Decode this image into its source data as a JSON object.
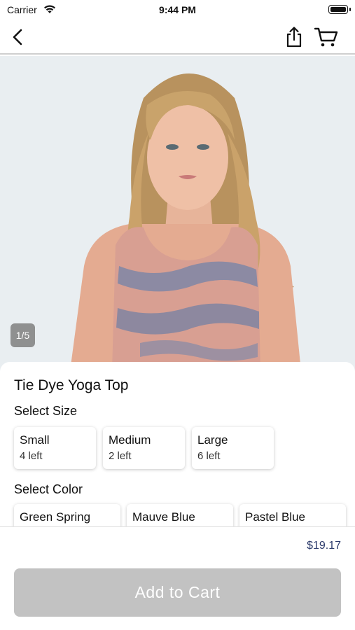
{
  "status_bar": {
    "carrier": "Carrier",
    "time": "9:44 PM"
  },
  "nav": {
    "back_icon": "chevron-left-icon",
    "share_icon": "share-icon",
    "cart_icon": "cart-icon"
  },
  "gallery": {
    "indicator": "1/5"
  },
  "product": {
    "title": "Tie Dye Yoga Top",
    "size_section_label": "Select Size",
    "sizes": [
      {
        "name": "Small",
        "stock": "4 left"
      },
      {
        "name": "Medium",
        "stock": "2 left"
      },
      {
        "name": "Large",
        "stock": "6 left"
      }
    ],
    "color_section_label": "Select Color",
    "colors": [
      {
        "name": "Green Spring"
      },
      {
        "name": "Mauve Blue"
      },
      {
        "name": "Pastel Blue"
      }
    ],
    "price": "$19.17"
  },
  "actions": {
    "add_to_cart_label": "Add to Cart"
  },
  "colors": {
    "price_text": "#2b3a6b",
    "button_disabled": "#c2c2c2",
    "hero_background": "#e9eef1"
  }
}
